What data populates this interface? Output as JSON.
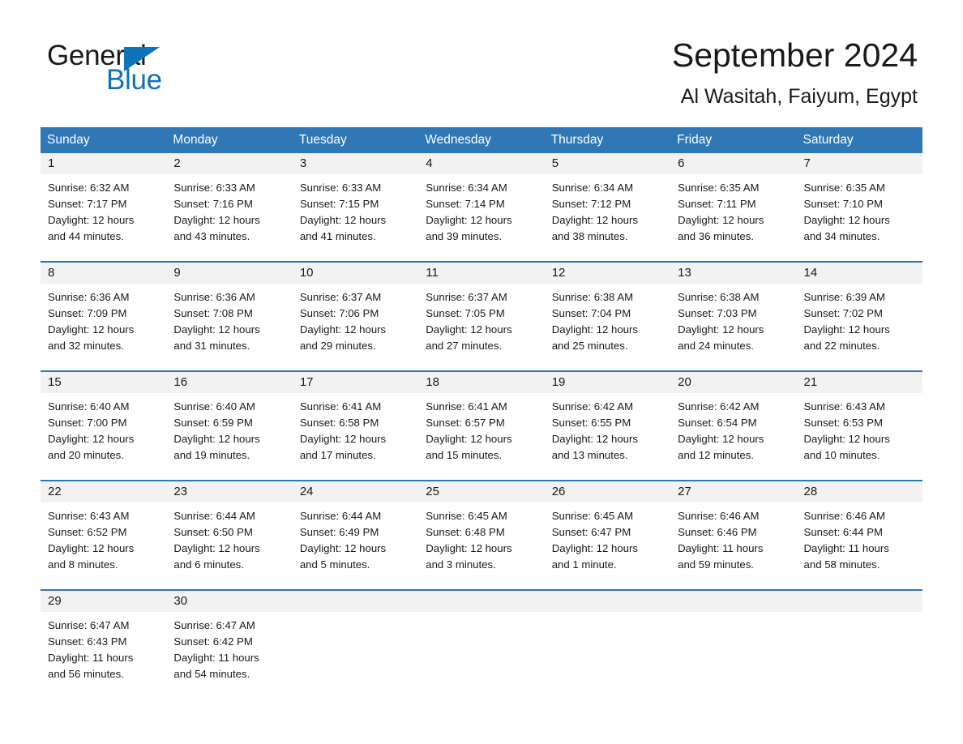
{
  "brand": {
    "name_part1": "General",
    "name_part2": "Blue",
    "triangle_icon": "triangle-icon",
    "accent_color": "#1072b8"
  },
  "header": {
    "title": "September 2024",
    "subtitle": "Al Wasitah, Faiyum, Egypt"
  },
  "theme": {
    "header_blue": "#3077b5",
    "daynum_band": "#f2f2f2",
    "text": "#1a1a1a"
  },
  "calendar": {
    "day_headers": [
      "Sunday",
      "Monday",
      "Tuesday",
      "Wednesday",
      "Thursday",
      "Friday",
      "Saturday"
    ],
    "weeks": [
      {
        "days": [
          {
            "num": "1",
            "sunrise": "Sunrise: 6:32 AM",
            "sunset": "Sunset: 7:17 PM",
            "daylight1": "Daylight: 12 hours",
            "daylight2": "and 44 minutes."
          },
          {
            "num": "2",
            "sunrise": "Sunrise: 6:33 AM",
            "sunset": "Sunset: 7:16 PM",
            "daylight1": "Daylight: 12 hours",
            "daylight2": "and 43 minutes."
          },
          {
            "num": "3",
            "sunrise": "Sunrise: 6:33 AM",
            "sunset": "Sunset: 7:15 PM",
            "daylight1": "Daylight: 12 hours",
            "daylight2": "and 41 minutes."
          },
          {
            "num": "4",
            "sunrise": "Sunrise: 6:34 AM",
            "sunset": "Sunset: 7:14 PM",
            "daylight1": "Daylight: 12 hours",
            "daylight2": "and 39 minutes."
          },
          {
            "num": "5",
            "sunrise": "Sunrise: 6:34 AM",
            "sunset": "Sunset: 7:12 PM",
            "daylight1": "Daylight: 12 hours",
            "daylight2": "and 38 minutes."
          },
          {
            "num": "6",
            "sunrise": "Sunrise: 6:35 AM",
            "sunset": "Sunset: 7:11 PM",
            "daylight1": "Daylight: 12 hours",
            "daylight2": "and 36 minutes."
          },
          {
            "num": "7",
            "sunrise": "Sunrise: 6:35 AM",
            "sunset": "Sunset: 7:10 PM",
            "daylight1": "Daylight: 12 hours",
            "daylight2": "and 34 minutes."
          }
        ]
      },
      {
        "days": [
          {
            "num": "8",
            "sunrise": "Sunrise: 6:36 AM",
            "sunset": "Sunset: 7:09 PM",
            "daylight1": "Daylight: 12 hours",
            "daylight2": "and 32 minutes."
          },
          {
            "num": "9",
            "sunrise": "Sunrise: 6:36 AM",
            "sunset": "Sunset: 7:08 PM",
            "daylight1": "Daylight: 12 hours",
            "daylight2": "and 31 minutes."
          },
          {
            "num": "10",
            "sunrise": "Sunrise: 6:37 AM",
            "sunset": "Sunset: 7:06 PM",
            "daylight1": "Daylight: 12 hours",
            "daylight2": "and 29 minutes."
          },
          {
            "num": "11",
            "sunrise": "Sunrise: 6:37 AM",
            "sunset": "Sunset: 7:05 PM",
            "daylight1": "Daylight: 12 hours",
            "daylight2": "and 27 minutes."
          },
          {
            "num": "12",
            "sunrise": "Sunrise: 6:38 AM",
            "sunset": "Sunset: 7:04 PM",
            "daylight1": "Daylight: 12 hours",
            "daylight2": "and 25 minutes."
          },
          {
            "num": "13",
            "sunrise": "Sunrise: 6:38 AM",
            "sunset": "Sunset: 7:03 PM",
            "daylight1": "Daylight: 12 hours",
            "daylight2": "and 24 minutes."
          },
          {
            "num": "14",
            "sunrise": "Sunrise: 6:39 AM",
            "sunset": "Sunset: 7:02 PM",
            "daylight1": "Daylight: 12 hours",
            "daylight2": "and 22 minutes."
          }
        ]
      },
      {
        "days": [
          {
            "num": "15",
            "sunrise": "Sunrise: 6:40 AM",
            "sunset": "Sunset: 7:00 PM",
            "daylight1": "Daylight: 12 hours",
            "daylight2": "and 20 minutes."
          },
          {
            "num": "16",
            "sunrise": "Sunrise: 6:40 AM",
            "sunset": "Sunset: 6:59 PM",
            "daylight1": "Daylight: 12 hours",
            "daylight2": "and 19 minutes."
          },
          {
            "num": "17",
            "sunrise": "Sunrise: 6:41 AM",
            "sunset": "Sunset: 6:58 PM",
            "daylight1": "Daylight: 12 hours",
            "daylight2": "and 17 minutes."
          },
          {
            "num": "18",
            "sunrise": "Sunrise: 6:41 AM",
            "sunset": "Sunset: 6:57 PM",
            "daylight1": "Daylight: 12 hours",
            "daylight2": "and 15 minutes."
          },
          {
            "num": "19",
            "sunrise": "Sunrise: 6:42 AM",
            "sunset": "Sunset: 6:55 PM",
            "daylight1": "Daylight: 12 hours",
            "daylight2": "and 13 minutes."
          },
          {
            "num": "20",
            "sunrise": "Sunrise: 6:42 AM",
            "sunset": "Sunset: 6:54 PM",
            "daylight1": "Daylight: 12 hours",
            "daylight2": "and 12 minutes."
          },
          {
            "num": "21",
            "sunrise": "Sunrise: 6:43 AM",
            "sunset": "Sunset: 6:53 PM",
            "daylight1": "Daylight: 12 hours",
            "daylight2": "and 10 minutes."
          }
        ]
      },
      {
        "days": [
          {
            "num": "22",
            "sunrise": "Sunrise: 6:43 AM",
            "sunset": "Sunset: 6:52 PM",
            "daylight1": "Daylight: 12 hours",
            "daylight2": "and 8 minutes."
          },
          {
            "num": "23",
            "sunrise": "Sunrise: 6:44 AM",
            "sunset": "Sunset: 6:50 PM",
            "daylight1": "Daylight: 12 hours",
            "daylight2": "and 6 minutes."
          },
          {
            "num": "24",
            "sunrise": "Sunrise: 6:44 AM",
            "sunset": "Sunset: 6:49 PM",
            "daylight1": "Daylight: 12 hours",
            "daylight2": "and 5 minutes."
          },
          {
            "num": "25",
            "sunrise": "Sunrise: 6:45 AM",
            "sunset": "Sunset: 6:48 PM",
            "daylight1": "Daylight: 12 hours",
            "daylight2": "and 3 minutes."
          },
          {
            "num": "26",
            "sunrise": "Sunrise: 6:45 AM",
            "sunset": "Sunset: 6:47 PM",
            "daylight1": "Daylight: 12 hours",
            "daylight2": "and 1 minute."
          },
          {
            "num": "27",
            "sunrise": "Sunrise: 6:46 AM",
            "sunset": "Sunset: 6:46 PM",
            "daylight1": "Daylight: 11 hours",
            "daylight2": "and 59 minutes."
          },
          {
            "num": "28",
            "sunrise": "Sunrise: 6:46 AM",
            "sunset": "Sunset: 6:44 PM",
            "daylight1": "Daylight: 11 hours",
            "daylight2": "and 58 minutes."
          }
        ]
      },
      {
        "days": [
          {
            "num": "29",
            "sunrise": "Sunrise: 6:47 AM",
            "sunset": "Sunset: 6:43 PM",
            "daylight1": "Daylight: 11 hours",
            "daylight2": "and 56 minutes."
          },
          {
            "num": "30",
            "sunrise": "Sunrise: 6:47 AM",
            "sunset": "Sunset: 6:42 PM",
            "daylight1": "Daylight: 11 hours",
            "daylight2": "and 54 minutes."
          },
          {
            "num": "",
            "sunrise": "",
            "sunset": "",
            "daylight1": "",
            "daylight2": ""
          },
          {
            "num": "",
            "sunrise": "",
            "sunset": "",
            "daylight1": "",
            "daylight2": ""
          },
          {
            "num": "",
            "sunrise": "",
            "sunset": "",
            "daylight1": "",
            "daylight2": ""
          },
          {
            "num": "",
            "sunrise": "",
            "sunset": "",
            "daylight1": "",
            "daylight2": ""
          },
          {
            "num": "",
            "sunrise": "",
            "sunset": "",
            "daylight1": "",
            "daylight2": ""
          }
        ]
      }
    ]
  }
}
